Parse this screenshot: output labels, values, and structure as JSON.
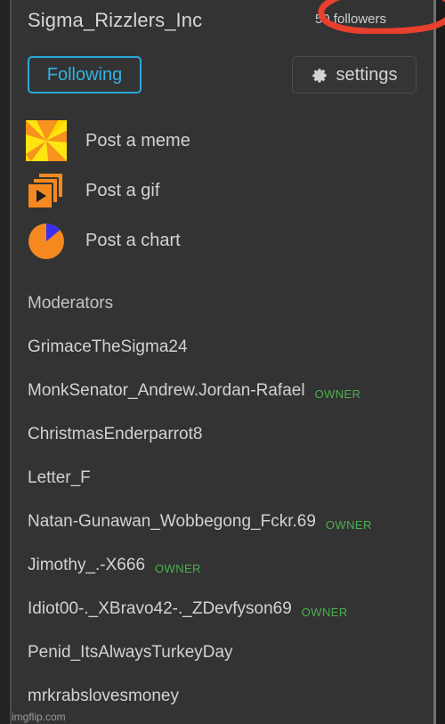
{
  "header": {
    "group_title": "Sigma_Rizzlers_Inc",
    "followers_label": "50 followers",
    "annotation_color": "#e8402e",
    "annotation_name": "red-circle-annotation"
  },
  "buttons": {
    "following_label": "Following",
    "following_color": "#2fb3e0",
    "settings_label": "settings",
    "settings_icon": "gear-icon"
  },
  "actions": [
    {
      "label": "Post a meme",
      "icon": "pinwheel-meme-icon"
    },
    {
      "label": "Post a gif",
      "icon": "gif-stack-play-icon"
    },
    {
      "label": "Post a chart",
      "icon": "pie-chart-icon"
    }
  ],
  "moderators": {
    "section_title": "Moderators",
    "owner_badge": "OWNER",
    "owner_badge_color": "#4caf50",
    "items": [
      {
        "name": "GrimaceTheSigma24",
        "owner": false
      },
      {
        "name": "MonkSenator_Andrew.Jordan-Rafael",
        "owner": true
      },
      {
        "name": "ChristmasEnderparrot8",
        "owner": false
      },
      {
        "name": "Letter_F",
        "owner": false
      },
      {
        "name": "Natan-Gunawan_Wobbegong_Fckr.69",
        "owner": true
      },
      {
        "name": "Jimothy_.-X666",
        "owner": true
      },
      {
        "name": "Idiot00-._XBravo42-._ZDevfyson69",
        "owner": true
      },
      {
        "name": "Penid_ItsAlwaysTurkeyDay",
        "owner": false
      },
      {
        "name": "mrkrabslovesmoney",
        "owner": false
      }
    ]
  },
  "watermark": {
    "text": "imgflip.com"
  },
  "theme": {
    "background": "#333333",
    "text": "#d2d2d2",
    "accent": "#2fb3e0",
    "icon_orange": "#f5891f",
    "icon_yellow": "#ffe512",
    "icon_blue": "#3b2ff0"
  }
}
